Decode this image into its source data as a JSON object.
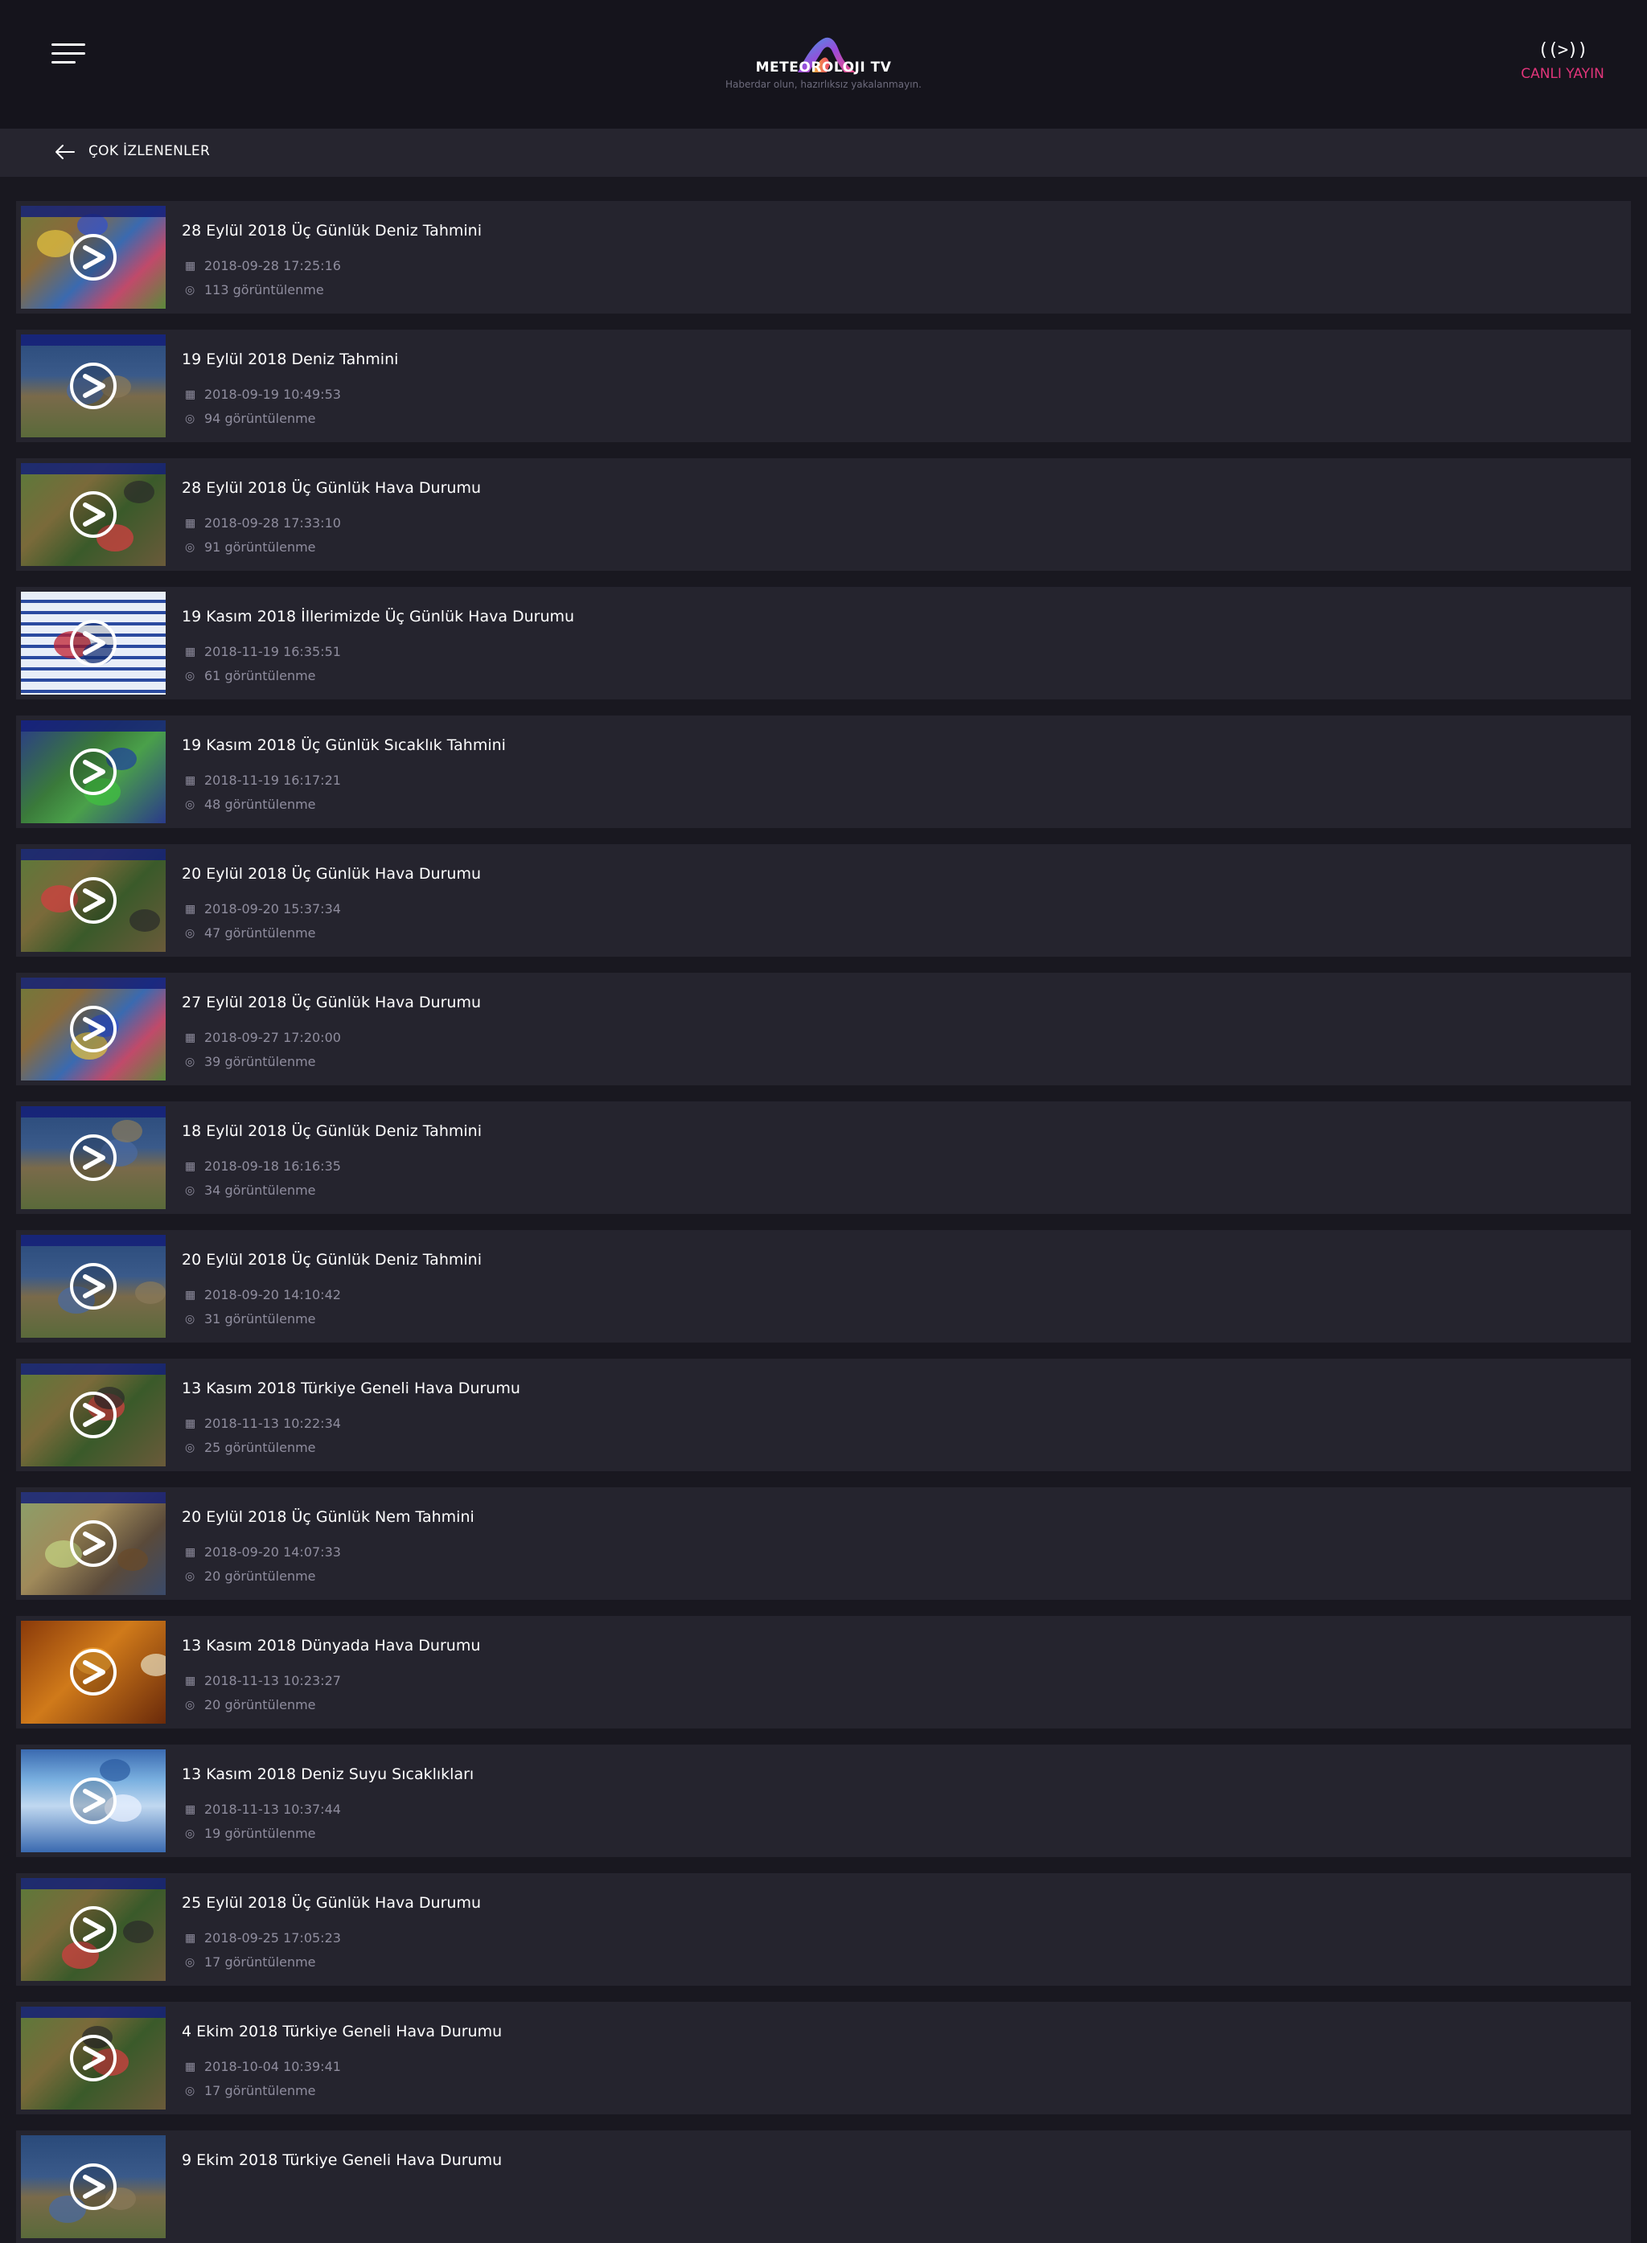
{
  "header": {
    "logo_text": "METEOROLOJI TV",
    "tagline": "Haberdar olun, hazırlıksız yakalanmayın.",
    "live_icon": "((>))",
    "live_label": "CANLI YAYIN",
    "live_color": "#e0357a"
  },
  "subheader": {
    "title": "ÇOK İZLENENLER"
  },
  "icons": {
    "menu": "hamburger-menu-icon",
    "back": "arrow-left-icon",
    "live": "broadcast-icon",
    "play": "play-icon",
    "date": "calendar-icon",
    "views": "eye-icon"
  },
  "videos": [
    {
      "title": "28 Eylül 2018 Üç Günlük Deniz Tahmini",
      "date": "2018-09-28 17:25:16",
      "views": "113 görüntülenme",
      "theme": "rainmap",
      "band": "30 Eylül 2018"
    },
    {
      "title": "19 Eylül 2018 Deniz Tahmini",
      "date": "2018-09-19 10:49:53",
      "views": "94 görüntülenme",
      "theme": "sea",
      "band": "19 Eylül 2018"
    },
    {
      "title": "28 Eylül 2018 Üç Günlük Hava Durumu",
      "date": "2018-09-28 17:33:10",
      "views": "91 görüntülenme",
      "theme": "presenter",
      "band": "29 Eylül 2018"
    },
    {
      "title": "19 Kasım 2018 İllerimizde Üç Günlük Hava Durumu",
      "date": "2018-11-19 16:35:51",
      "views": "61 görüntülenme",
      "theme": "table",
      "band": ""
    },
    {
      "title": "19 Kasım 2018 Üç Günlük Sıcaklık Tahmini",
      "date": "2018-11-19 16:17:21",
      "views": "48 görüntülenme",
      "theme": "tempmap",
      "band": "20 Kasım 2018"
    },
    {
      "title": "20 Eylül 2018 Üç Günlük Hava Durumu",
      "date": "2018-09-20 15:37:34",
      "views": "47 görüntülenme",
      "theme": "presenter",
      "band": "21 Eylül 2018"
    },
    {
      "title": "27 Eylül 2018 Üç Günlük Hava Durumu",
      "date": "2018-09-27 17:20:00",
      "views": "39 görüntülenme",
      "theme": "rainmap",
      "band": "29 Eylül 2018"
    },
    {
      "title": "18 Eylül 2018 Üç Günlük Deniz Tahmini",
      "date": "2018-09-18 16:16:35",
      "views": "34 görüntülenme",
      "theme": "sea",
      "band": "18 Eylül 2018"
    },
    {
      "title": "20 Eylül 2018 Üç Günlük Deniz Tahmini",
      "date": "2018-09-20 14:10:42",
      "views": "31 görüntülenme",
      "theme": "sea",
      "band": "20 Eylül 2018"
    },
    {
      "title": "13 Kasım 2018 Türkiye Geneli Hava Durumu",
      "date": "2018-11-13 10:22:34",
      "views": "25 görüntülenme",
      "theme": "presenter",
      "band": "13 Kasım 2018"
    },
    {
      "title": "20 Eylül 2018 Üç Günlük Nem Tahmini",
      "date": "2018-09-20 14:07:33",
      "views": "20 görüntülenme",
      "theme": "humidity",
      "band": "21 Eylül 2018"
    },
    {
      "title": "13 Kasım 2018 Dünyada Hava Durumu",
      "date": "2018-11-13 10:23:27",
      "views": "20 görüntülenme",
      "theme": "world",
      "band": ""
    },
    {
      "title": "13 Kasım 2018 Deniz Suyu Sıcaklıkları",
      "date": "2018-11-13 10:37:44",
      "views": "19 görüntülenme",
      "theme": "seatemp",
      "band": ""
    },
    {
      "title": "25 Eylül 2018 Üç Günlük Hava Durumu",
      "date": "2018-09-25 17:05:23",
      "views": "17 görüntülenme",
      "theme": "presenter",
      "band": "26 Eylül 2018"
    },
    {
      "title": "4 Ekim 2018 Türkiye Geneli Hava Durumu",
      "date": "2018-10-04 10:39:41",
      "views": "17 görüntülenme",
      "theme": "presenter",
      "band": "4 Ekim 2018"
    },
    {
      "title": "9 Ekim 2018 Türkiye Geneli Hava Durumu",
      "date": "",
      "views": "",
      "theme": "sea",
      "band": ""
    }
  ]
}
